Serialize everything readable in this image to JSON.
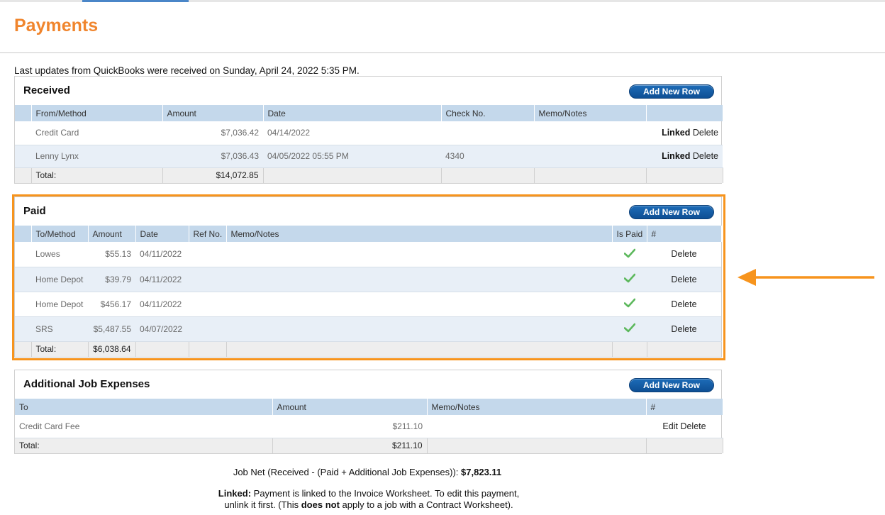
{
  "page": {
    "title": "Payments",
    "qb_note": "Last updates from QuickBooks were received on Sunday, April 24, 2022 5:35 PM."
  },
  "received": {
    "title": "Received",
    "add_label": "Add New Row",
    "columns": [
      "From/Method",
      "Amount",
      "Date",
      "Check No.",
      "Memo/Notes",
      ""
    ],
    "rows": [
      {
        "from": "Credit Card",
        "amount": "$7,036.42",
        "date": "04/14/2022",
        "check": "",
        "memo": "",
        "linked": "Linked",
        "delete": "Delete"
      },
      {
        "from": "Lenny Lynx",
        "amount": "$7,036.43",
        "date": "04/05/2022 05:55 PM",
        "check": "4340",
        "memo": "",
        "linked": "Linked",
        "delete": "Delete"
      }
    ],
    "total_label": "Total:",
    "total_amount": "$14,072.85"
  },
  "paid": {
    "title": "Paid",
    "add_label": "Add New Row",
    "columns": [
      "To/Method",
      "Amount",
      "Date",
      "Ref No.",
      "Memo/Notes",
      "Is Paid",
      "#"
    ],
    "rows": [
      {
        "to": "Lowes",
        "amount": "$55.13",
        "date": "04/11/2022",
        "ref": "",
        "memo": "",
        "is_paid": true,
        "delete": "Delete"
      },
      {
        "to": "Home Depot",
        "amount": "$39.79",
        "date": "04/11/2022",
        "ref": "",
        "memo": "",
        "is_paid": true,
        "delete": "Delete"
      },
      {
        "to": "Home Depot",
        "amount": "$456.17",
        "date": "04/11/2022",
        "ref": "",
        "memo": "",
        "is_paid": true,
        "delete": "Delete"
      },
      {
        "to": "SRS",
        "amount": "$5,487.55",
        "date": "04/07/2022",
        "ref": "",
        "memo": "",
        "is_paid": true,
        "delete": "Delete"
      }
    ],
    "total_label": "Total:",
    "total_amount": "$6,038.64"
  },
  "expenses": {
    "title": "Additional Job Expenses",
    "add_label": "Add New Row",
    "columns": [
      "To",
      "Amount",
      "Memo/Notes",
      "#"
    ],
    "rows": [
      {
        "to": "Credit Card Fee",
        "amount": "$211.10",
        "memo": "",
        "edit": "Edit",
        "delete": "Delete"
      }
    ],
    "total_label": "Total:",
    "total_amount": "$211.10"
  },
  "summary": {
    "job_net_label": "Job Net (Received - (Paid + Additional Job Expenses)):",
    "job_net_value": "$7,823.11",
    "linked_bold": "Linked:",
    "linked_text_1": "Payment is linked to the Invoice Worksheet. To edit this payment,",
    "linked_text_2": "unlink it first. (This",
    "linked_does_not": "does not",
    "linked_text_3": "apply to a job with a Contract Worksheet)."
  },
  "colors": {
    "title_orange": "#f0852d",
    "highlight_orange": "#f7941d",
    "button_blue": "#0e4f94",
    "header_blue": "#c4d8eb",
    "check_green": "#5cb85c"
  },
  "icons": {
    "is_paid": "check-icon",
    "annotation": "arrow-left-icon"
  }
}
